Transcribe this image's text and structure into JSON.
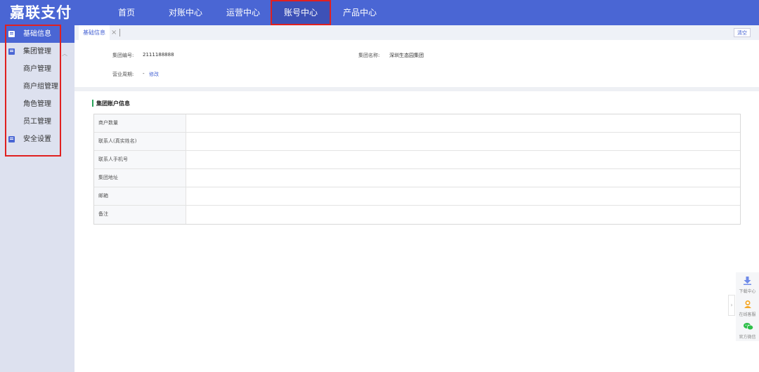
{
  "header": {
    "logo": "嘉联支付",
    "nav": [
      {
        "label": "首页"
      },
      {
        "label": "对账中心"
      },
      {
        "label": "运营中心"
      },
      {
        "label": "账号中心"
      },
      {
        "label": "产品中心"
      }
    ],
    "active_nav": "账号中心"
  },
  "sidebar": {
    "items": [
      {
        "label": "基础信息",
        "icon": "doc-icon",
        "active": true
      },
      {
        "label": "集团管理",
        "icon": "list-icon",
        "expanded": true
      },
      {
        "label": "商户管理"
      },
      {
        "label": "商户组管理"
      },
      {
        "label": "角色管理"
      },
      {
        "label": "员工管理"
      },
      {
        "label": "安全设置",
        "icon": "shield-icon"
      }
    ]
  },
  "tabs": {
    "items": [
      {
        "label": "基础信息"
      }
    ],
    "close_glyph": "×",
    "clear_label": "清空"
  },
  "group_info": {
    "group_no_label": "集团编号:",
    "group_no_value": "2111188888",
    "group_name_label": "集团名称:",
    "group_name_value": "深圳生态园集团",
    "business_period_label": "营业周期:",
    "business_period_value": "-",
    "edit_label": "修改"
  },
  "account_info": {
    "title": "集团账户信息",
    "rows": [
      {
        "label": "商户数量",
        "value": ""
      },
      {
        "label": "联系人(真实姓名)",
        "value": ""
      },
      {
        "label": "联系人手机号",
        "value": ""
      },
      {
        "label": "集团地址",
        "value": ""
      },
      {
        "label": "邮箱",
        "value": ""
      },
      {
        "label": "备注",
        "value": ""
      }
    ]
  },
  "float_tools": {
    "toggle_glyph": "›",
    "items": [
      {
        "label": "下载中心",
        "icon": "download-icon"
      },
      {
        "label": "在线客服",
        "icon": "customer-service-icon"
      },
      {
        "label": "官方微信",
        "icon": "wechat-icon"
      }
    ]
  },
  "colors": {
    "primary": "#4a66d4",
    "highlight_border": "#e02020",
    "section_accent": "#2aa35a",
    "sidebar_bg": "#dde1ef"
  }
}
